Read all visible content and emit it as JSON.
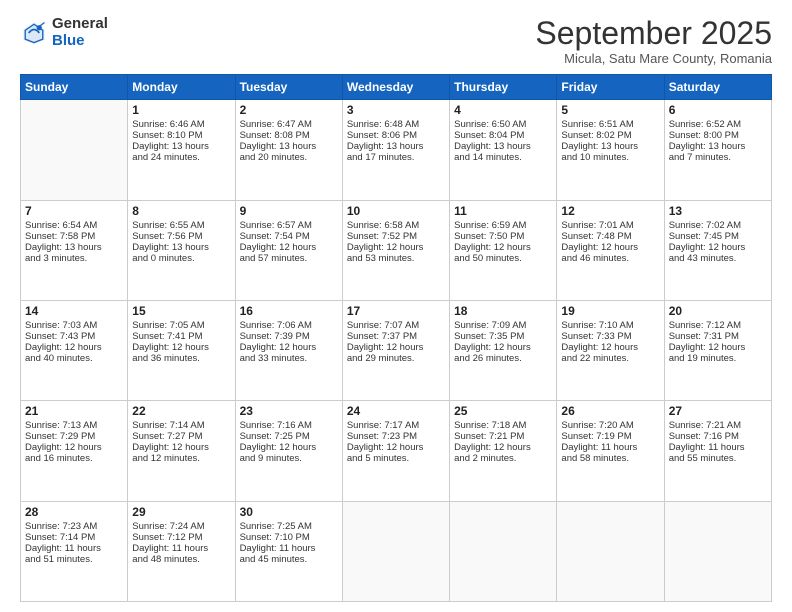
{
  "logo": {
    "general": "General",
    "blue": "Blue"
  },
  "title": "September 2025",
  "location": "Micula, Satu Mare County, Romania",
  "days_header": [
    "Sunday",
    "Monday",
    "Tuesday",
    "Wednesday",
    "Thursday",
    "Friday",
    "Saturday"
  ],
  "weeks": [
    [
      {
        "day": "",
        "info": ""
      },
      {
        "day": "1",
        "info": "Sunrise: 6:46 AM\nSunset: 8:10 PM\nDaylight: 13 hours\nand 24 minutes."
      },
      {
        "day": "2",
        "info": "Sunrise: 6:47 AM\nSunset: 8:08 PM\nDaylight: 13 hours\nand 20 minutes."
      },
      {
        "day": "3",
        "info": "Sunrise: 6:48 AM\nSunset: 8:06 PM\nDaylight: 13 hours\nand 17 minutes."
      },
      {
        "day": "4",
        "info": "Sunrise: 6:50 AM\nSunset: 8:04 PM\nDaylight: 13 hours\nand 14 minutes."
      },
      {
        "day": "5",
        "info": "Sunrise: 6:51 AM\nSunset: 8:02 PM\nDaylight: 13 hours\nand 10 minutes."
      },
      {
        "day": "6",
        "info": "Sunrise: 6:52 AM\nSunset: 8:00 PM\nDaylight: 13 hours\nand 7 minutes."
      }
    ],
    [
      {
        "day": "7",
        "info": "Sunrise: 6:54 AM\nSunset: 7:58 PM\nDaylight: 13 hours\nand 3 minutes."
      },
      {
        "day": "8",
        "info": "Sunrise: 6:55 AM\nSunset: 7:56 PM\nDaylight: 13 hours\nand 0 minutes."
      },
      {
        "day": "9",
        "info": "Sunrise: 6:57 AM\nSunset: 7:54 PM\nDaylight: 12 hours\nand 57 minutes."
      },
      {
        "day": "10",
        "info": "Sunrise: 6:58 AM\nSunset: 7:52 PM\nDaylight: 12 hours\nand 53 minutes."
      },
      {
        "day": "11",
        "info": "Sunrise: 6:59 AM\nSunset: 7:50 PM\nDaylight: 12 hours\nand 50 minutes."
      },
      {
        "day": "12",
        "info": "Sunrise: 7:01 AM\nSunset: 7:48 PM\nDaylight: 12 hours\nand 46 minutes."
      },
      {
        "day": "13",
        "info": "Sunrise: 7:02 AM\nSunset: 7:45 PM\nDaylight: 12 hours\nand 43 minutes."
      }
    ],
    [
      {
        "day": "14",
        "info": "Sunrise: 7:03 AM\nSunset: 7:43 PM\nDaylight: 12 hours\nand 40 minutes."
      },
      {
        "day": "15",
        "info": "Sunrise: 7:05 AM\nSunset: 7:41 PM\nDaylight: 12 hours\nand 36 minutes."
      },
      {
        "day": "16",
        "info": "Sunrise: 7:06 AM\nSunset: 7:39 PM\nDaylight: 12 hours\nand 33 minutes."
      },
      {
        "day": "17",
        "info": "Sunrise: 7:07 AM\nSunset: 7:37 PM\nDaylight: 12 hours\nand 29 minutes."
      },
      {
        "day": "18",
        "info": "Sunrise: 7:09 AM\nSunset: 7:35 PM\nDaylight: 12 hours\nand 26 minutes."
      },
      {
        "day": "19",
        "info": "Sunrise: 7:10 AM\nSunset: 7:33 PM\nDaylight: 12 hours\nand 22 minutes."
      },
      {
        "day": "20",
        "info": "Sunrise: 7:12 AM\nSunset: 7:31 PM\nDaylight: 12 hours\nand 19 minutes."
      }
    ],
    [
      {
        "day": "21",
        "info": "Sunrise: 7:13 AM\nSunset: 7:29 PM\nDaylight: 12 hours\nand 16 minutes."
      },
      {
        "day": "22",
        "info": "Sunrise: 7:14 AM\nSunset: 7:27 PM\nDaylight: 12 hours\nand 12 minutes."
      },
      {
        "day": "23",
        "info": "Sunrise: 7:16 AM\nSunset: 7:25 PM\nDaylight: 12 hours\nand 9 minutes."
      },
      {
        "day": "24",
        "info": "Sunrise: 7:17 AM\nSunset: 7:23 PM\nDaylight: 12 hours\nand 5 minutes."
      },
      {
        "day": "25",
        "info": "Sunrise: 7:18 AM\nSunset: 7:21 PM\nDaylight: 12 hours\nand 2 minutes."
      },
      {
        "day": "26",
        "info": "Sunrise: 7:20 AM\nSunset: 7:19 PM\nDaylight: 11 hours\nand 58 minutes."
      },
      {
        "day": "27",
        "info": "Sunrise: 7:21 AM\nSunset: 7:16 PM\nDaylight: 11 hours\nand 55 minutes."
      }
    ],
    [
      {
        "day": "28",
        "info": "Sunrise: 7:23 AM\nSunset: 7:14 PM\nDaylight: 11 hours\nand 51 minutes."
      },
      {
        "day": "29",
        "info": "Sunrise: 7:24 AM\nSunset: 7:12 PM\nDaylight: 11 hours\nand 48 minutes."
      },
      {
        "day": "30",
        "info": "Sunrise: 7:25 AM\nSunset: 7:10 PM\nDaylight: 11 hours\nand 45 minutes."
      },
      {
        "day": "",
        "info": ""
      },
      {
        "day": "",
        "info": ""
      },
      {
        "day": "",
        "info": ""
      },
      {
        "day": "",
        "info": ""
      }
    ]
  ]
}
